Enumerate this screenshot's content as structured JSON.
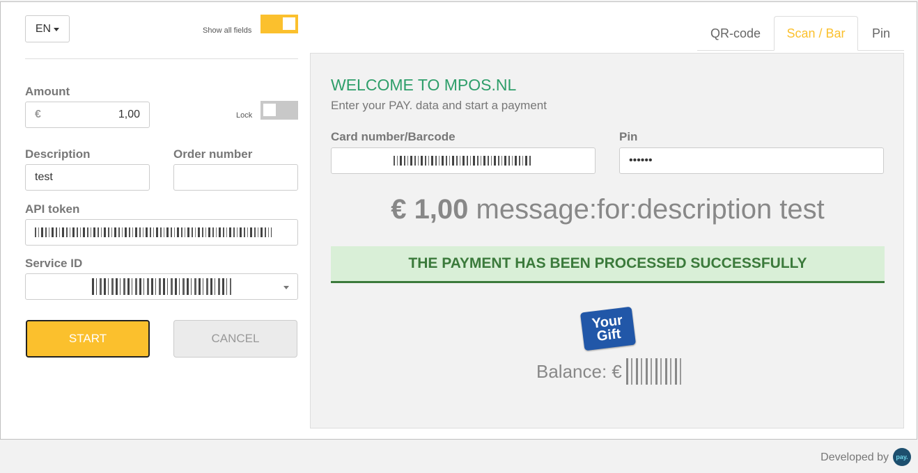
{
  "settings": {
    "language": "EN",
    "show_all_fields_label": "Show all fields",
    "show_all_fields_on": true,
    "lock_label": "Lock",
    "lock_on": false
  },
  "form": {
    "amount_label": "Amount",
    "amount_prefix": "€",
    "amount_value": "1,00",
    "description_label": "Description",
    "description_value": "test",
    "order_number_label": "Order number",
    "order_number_value": "",
    "api_token_label": "API token",
    "service_id_label": "Service ID"
  },
  "buttons": {
    "start": "START",
    "cancel": "CANCEL"
  },
  "tabs": [
    {
      "label": "QR-code",
      "active": false
    },
    {
      "label": "Scan / Bar",
      "active": true
    },
    {
      "label": "Pin",
      "active": false
    }
  ],
  "panel": {
    "welcome": "WELCOME TO MPOS.NL",
    "subtitle": "Enter your PAY. data and start a payment",
    "card_label": "Card number/Barcode",
    "pin_label": "Pin",
    "pin_value": "••••••",
    "amount_display": "€ 1,00",
    "message_display": "message:for:description test",
    "success_message": "THE PAYMENT HAS BEEN PROCESSED SUCCESSFULLY",
    "logo_line1": "Your",
    "logo_line2": "Gift",
    "balance_label": "Balance: €"
  },
  "footer": {
    "developed_by": "Developed by",
    "logo_text": "pay."
  },
  "colors": {
    "accent": "#fbc02d",
    "welcome": "#2e9e6a",
    "success_bg": "#d9efd7",
    "success_text": "#3b7a3b",
    "gift_logo": "#2157a8"
  }
}
